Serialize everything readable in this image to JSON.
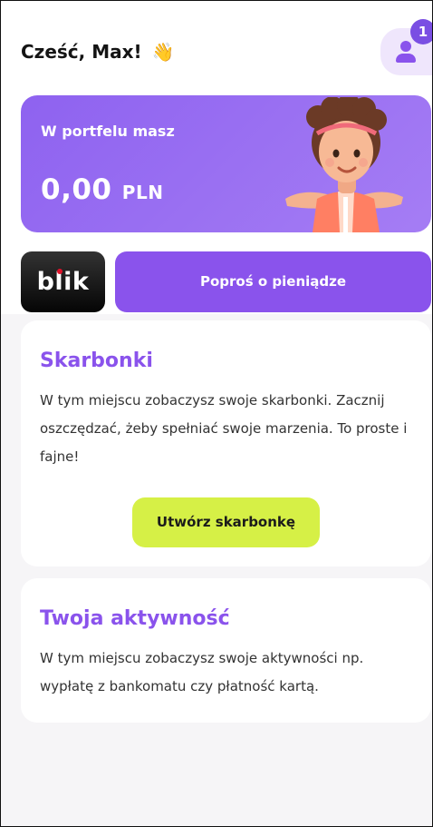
{
  "header": {
    "greeting": "Cześć, Max!",
    "wave_emoji": "👋",
    "notification_count": "1",
    "profile_icon": "user-icon"
  },
  "wallet": {
    "label": "W portfelu masz",
    "amount": "0,00",
    "currency": "PLN"
  },
  "actions": {
    "blik_label": "blik",
    "request_money_label": "Poproś o pieniądze"
  },
  "piggy_banks": {
    "title": "Skarbonki",
    "description": "W tym miejscu zobaczysz swoje skarbonki. Zacznij oszczędzać, żeby spełniać swoje marzenia. To proste i fajne!",
    "create_button": "Utwórz skarbonkę"
  },
  "activity": {
    "title": "Twoja aktywność",
    "description": "W tym miejscu zobaczysz swoje aktywności np. wypłatę z bankomatu czy płatność kartą."
  },
  "colors": {
    "primary": "#8a53ec",
    "accent_lime": "#d6f046",
    "badge": "#7a4fe3",
    "blik_bg": "#111111"
  }
}
